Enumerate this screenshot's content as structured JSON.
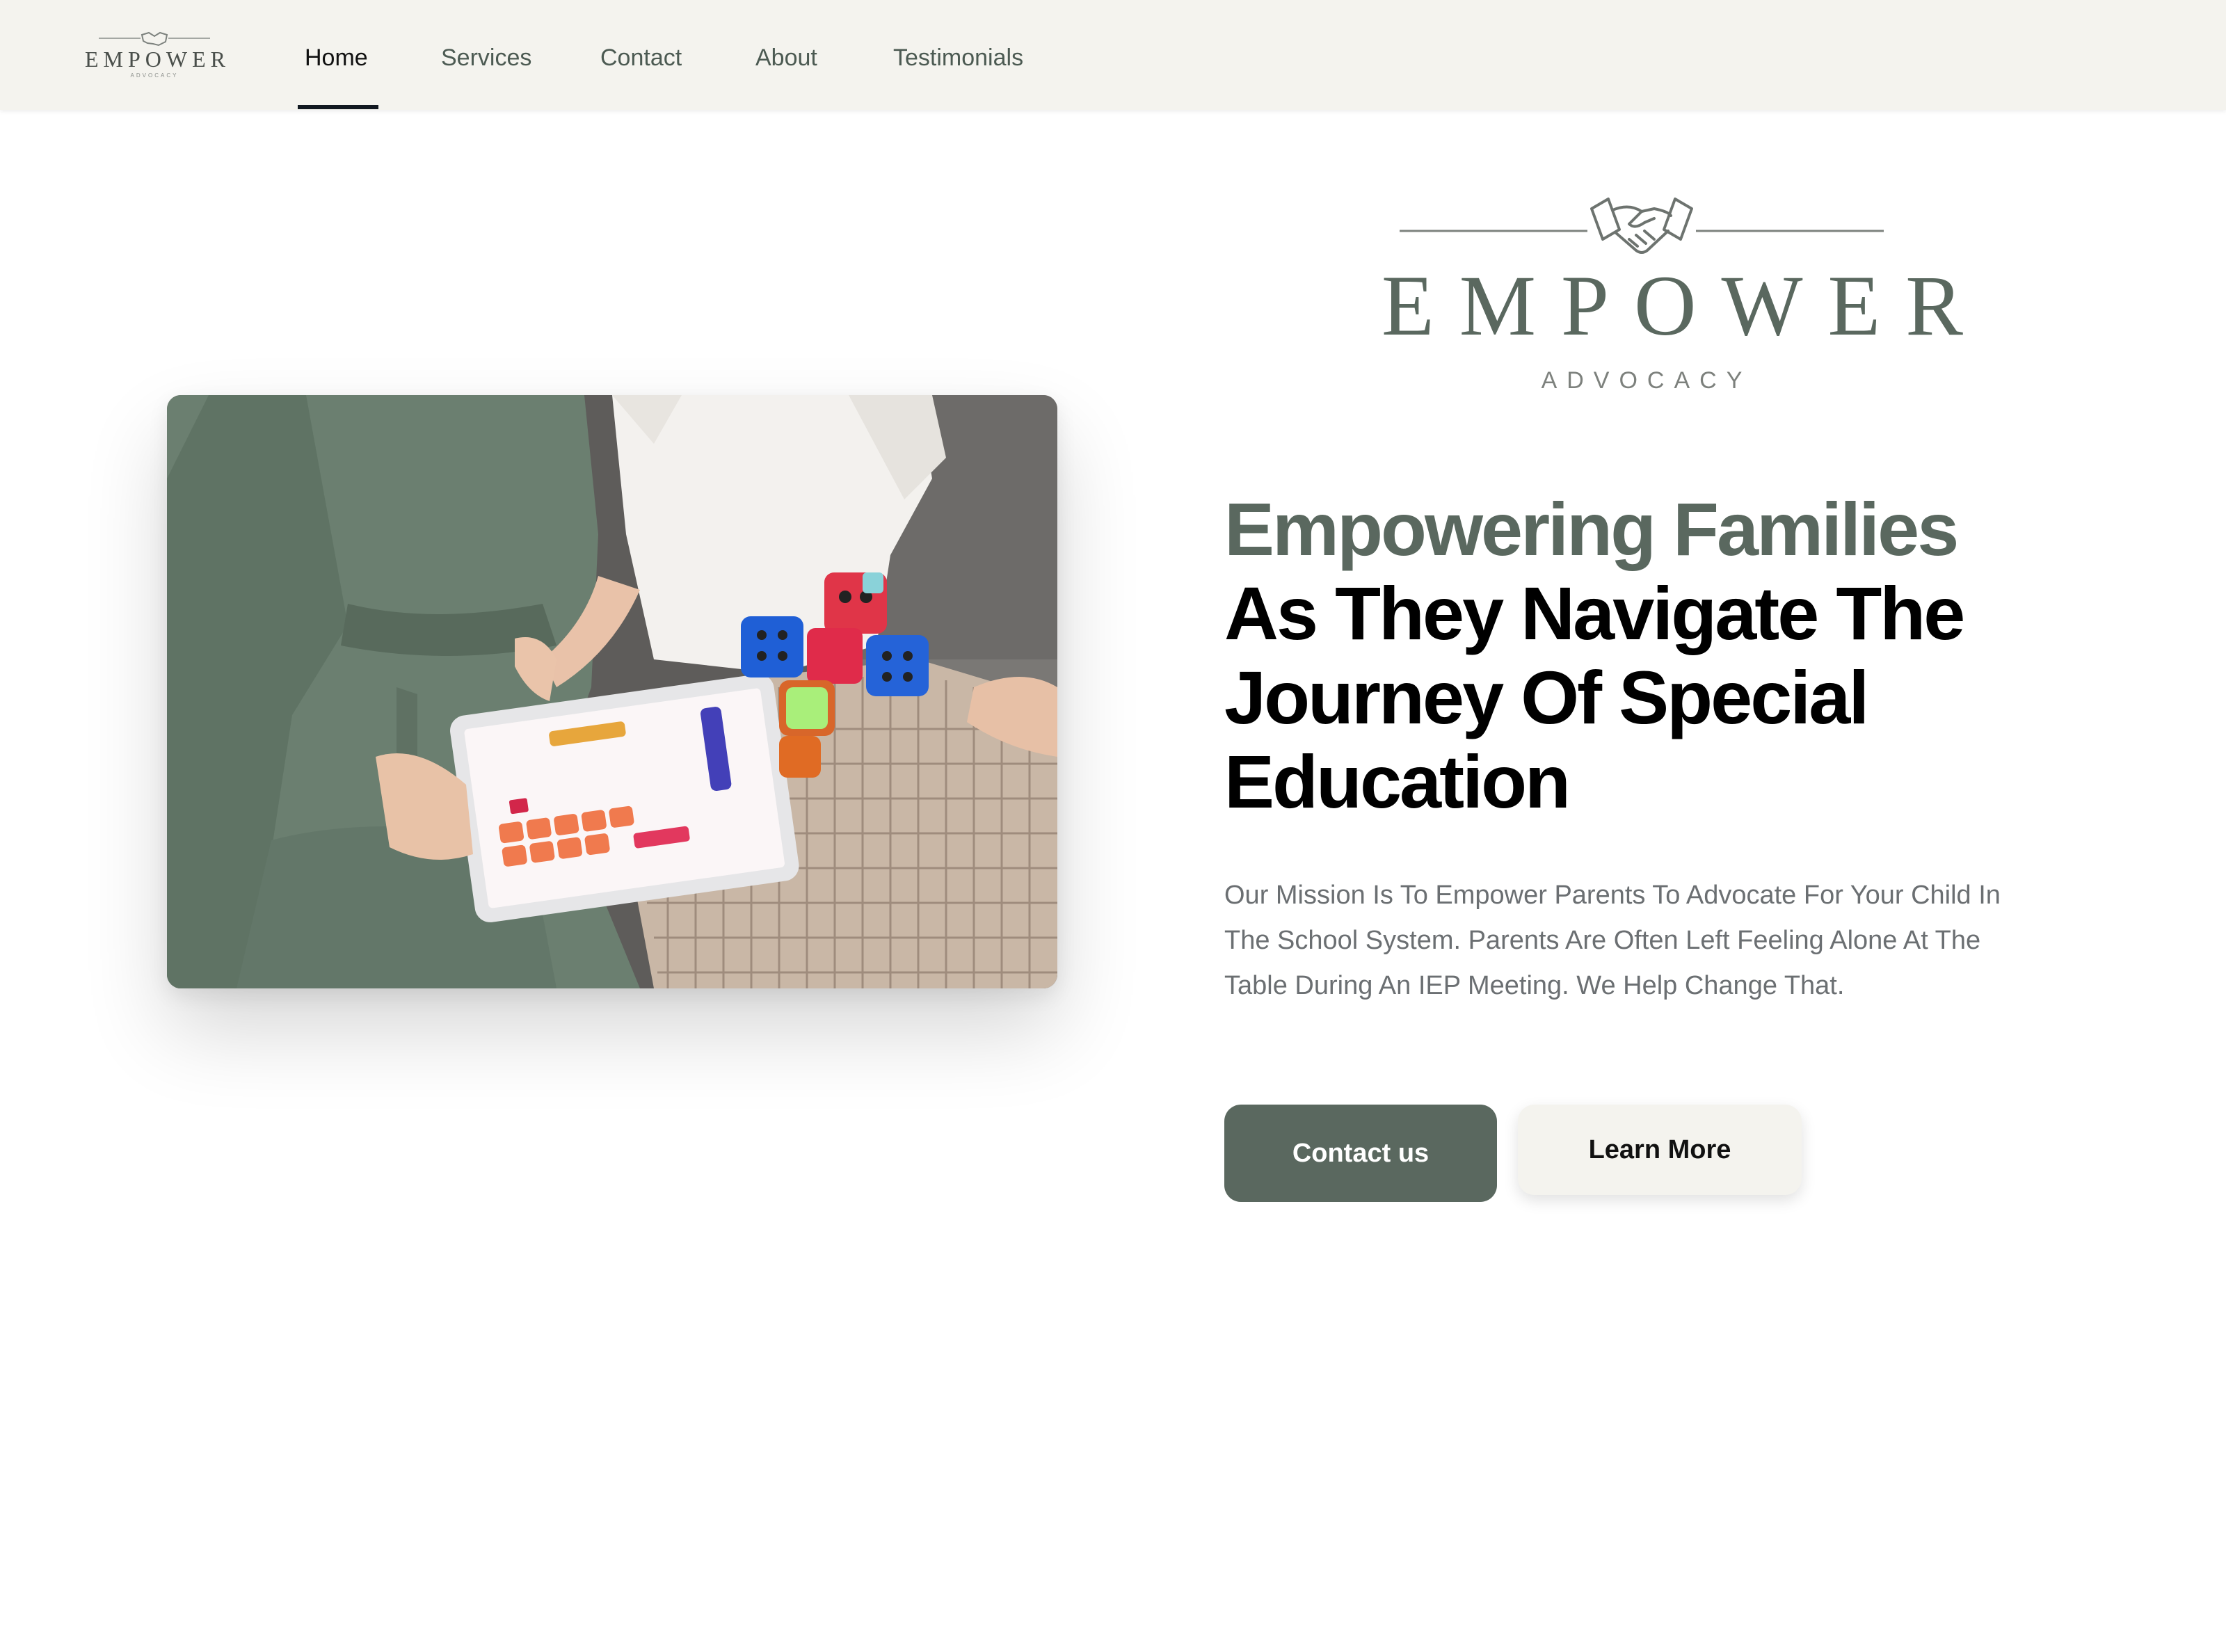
{
  "nav": {
    "logo": {
      "word": "EMPOWER",
      "sub": "ADVOCACY",
      "icon": "handshake-icon"
    },
    "items": [
      {
        "label": "Home",
        "active": true
      },
      {
        "label": "Services",
        "active": false
      },
      {
        "label": "Contact",
        "active": false
      },
      {
        "label": "About",
        "active": false
      },
      {
        "label": "Testimonials",
        "active": false
      }
    ]
  },
  "hero": {
    "image": "mother-and-child-using-tablet-with-toy-robot-cubes",
    "brand": {
      "word": "EMPOWER",
      "sub": "ADVOCACY",
      "icon": "handshake-icon"
    },
    "headline_accent": "Empowering Families",
    "headline_rest": "As They Navigate The Journey Of Special Education",
    "mission": "Our Mission Is To Empower Parents To Advocate For Your Child In The School System. Parents Are Often Left Feeling Alone At The Table During An IEP Meeting. We Help Change That.",
    "primary_button": "Contact us",
    "secondary_button": "Learn More"
  },
  "colors": {
    "brand_green": "#5a685f",
    "nav_background": "#f4f3ee",
    "headline_text": "#000000",
    "body_text": "#6b6f72"
  }
}
